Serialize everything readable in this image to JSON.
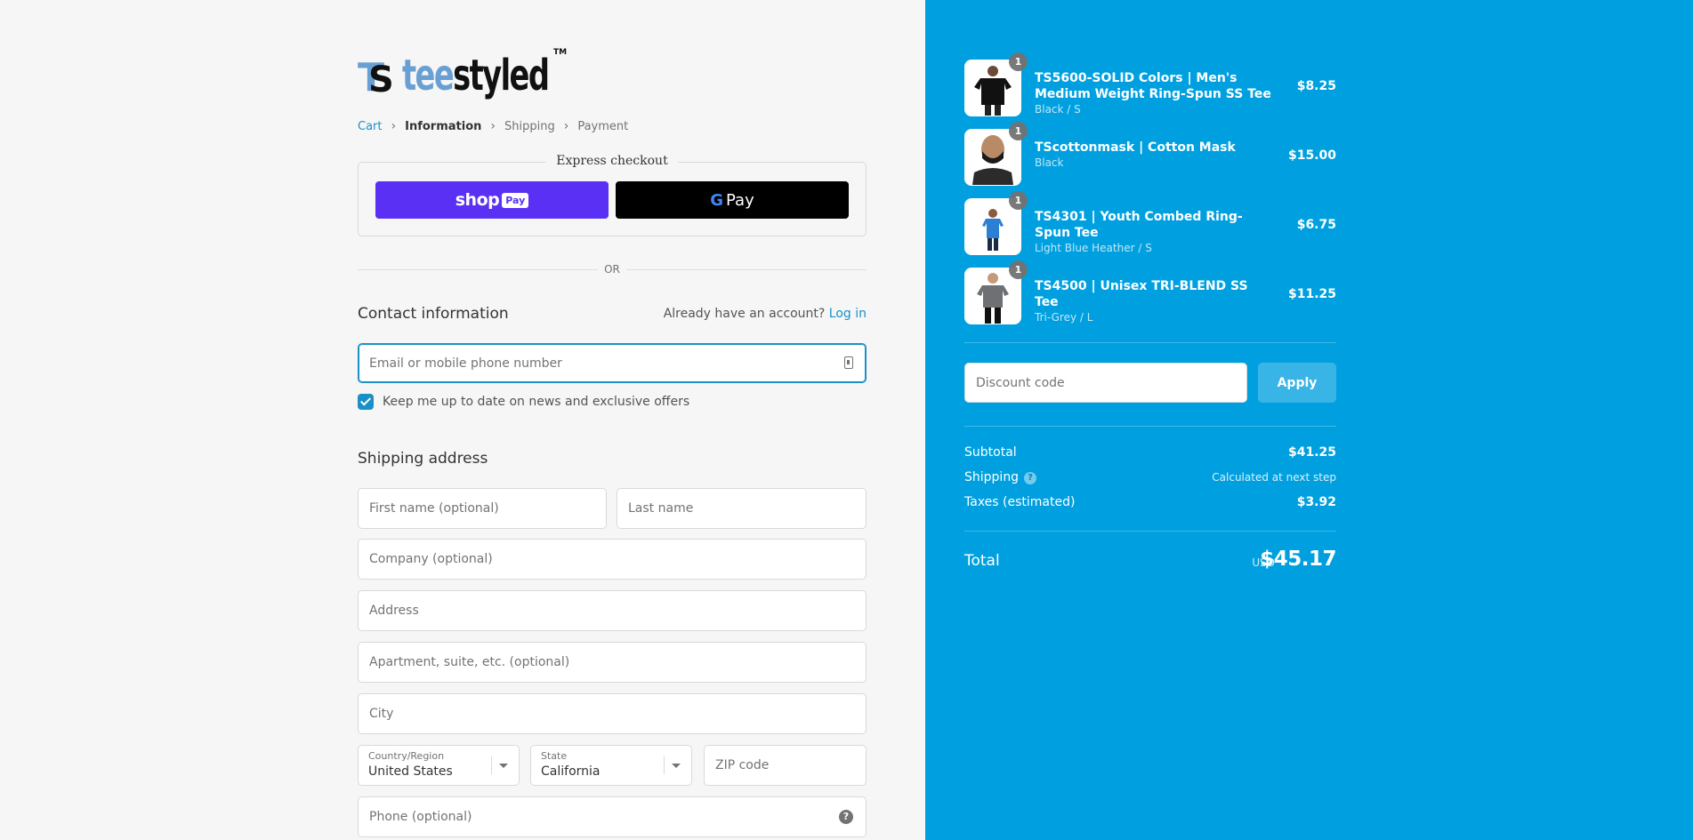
{
  "brand": {
    "tee": "tee",
    "styled": "styled",
    "tm": "TM",
    "mark_a": "T",
    "mark_b": "S"
  },
  "breadcrumb": {
    "cart": "Cart",
    "information": "Information",
    "shipping": "Shipping",
    "payment": "Payment"
  },
  "express": {
    "title": "Express checkout",
    "shop_label": "shop",
    "shop_pay_badge": "Pay",
    "gpay_g": "G",
    "gpay_label": "Pay"
  },
  "or_label": "OR",
  "contact": {
    "title": "Contact information",
    "account_prompt": "Already have an account?",
    "login_label": "Log in",
    "email_placeholder": "Email or mobile phone number",
    "newsletter_label": "Keep me up to date on news and exclusive offers",
    "newsletter_checked": true
  },
  "shipping_address": {
    "title": "Shipping address",
    "first_name_placeholder": "First name (optional)",
    "last_name_placeholder": "Last name",
    "company_placeholder": "Company (optional)",
    "address_placeholder": "Address",
    "apartment_placeholder": "Apartment, suite, etc. (optional)",
    "city_placeholder": "City",
    "country_label": "Country/Region",
    "country_value": "United States",
    "state_label": "State",
    "state_value": "California",
    "zip_placeholder": "ZIP code",
    "phone_placeholder": "Phone (optional)",
    "phone_help": "?"
  },
  "cart": {
    "items": [
      {
        "qty": "1",
        "title": "TS5600-SOLID Colors | Men's Medium Weight Ring-Spun SS Tee",
        "variant": "Black / S",
        "price": "$8.25"
      },
      {
        "qty": "1",
        "title": "TScottonmask | Cotton Mask",
        "variant": "Black",
        "price": "$15.00"
      },
      {
        "qty": "1",
        "title": "TS4301 | Youth Combed Ring-Spun Tee",
        "variant": "Light Blue Heather / S",
        "price": "$6.75"
      },
      {
        "qty": "1",
        "title": "TS4500 | Unisex TRI-BLEND SS Tee",
        "variant": "Tri-Grey / L",
        "price": "$11.25"
      }
    ],
    "discount_placeholder": "Discount code",
    "apply_label": "Apply"
  },
  "summary": {
    "subtotal_label": "Subtotal",
    "subtotal_value": "$41.25",
    "shipping_label": "Shipping",
    "shipping_help": "?",
    "shipping_value": "Calculated at next step",
    "taxes_label": "Taxes (estimated)",
    "taxes_value": "$3.92",
    "total_label": "Total",
    "currency": "USD",
    "total_value": "$45.17"
  },
  "colors": {
    "accent": "#1990c6",
    "sidebar_bg": "#00a0e0",
    "shop_pay": "#5a31f4"
  }
}
